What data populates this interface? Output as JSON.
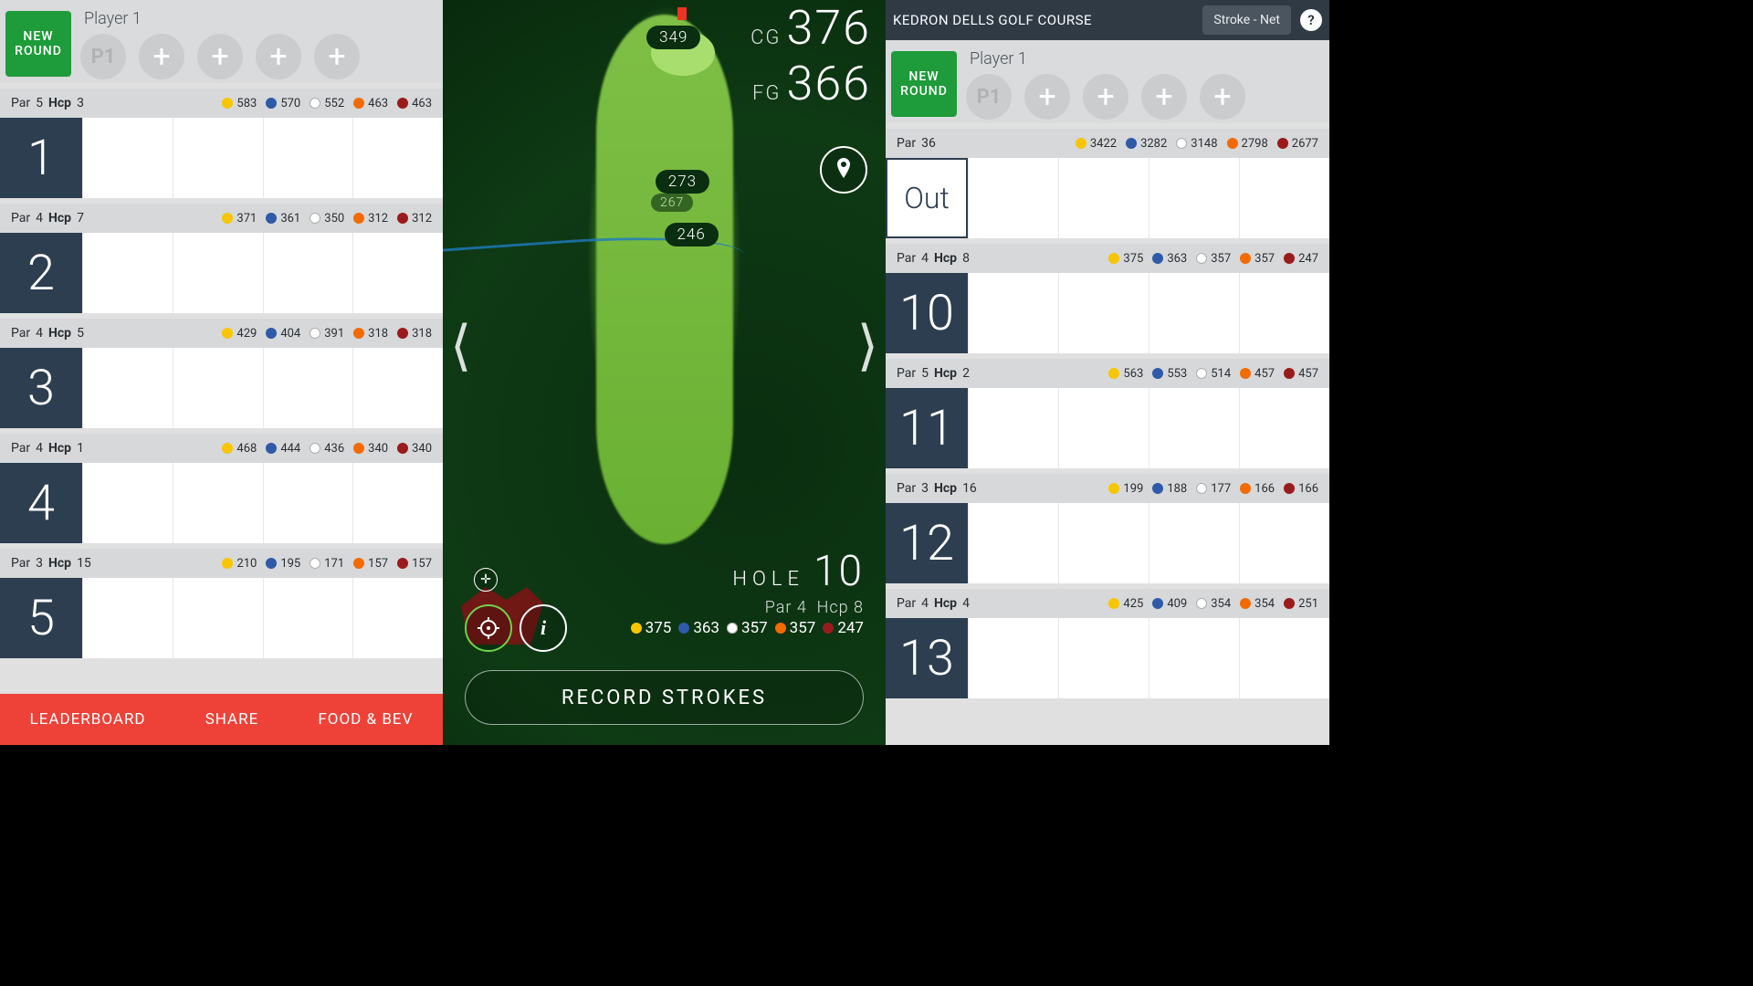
{
  "common": {
    "new_round_l1": "NEW",
    "new_round_l2": "ROUND",
    "player1_label": "Player 1",
    "p1": "P1",
    "par_label": "Par",
    "hcp_label": "Hcp"
  },
  "left": {
    "holes": [
      {
        "num": "1",
        "par": "5",
        "hcp": "3",
        "tees": [
          "583",
          "570",
          "552",
          "463",
          "463"
        ]
      },
      {
        "num": "2",
        "par": "4",
        "hcp": "7",
        "tees": [
          "371",
          "361",
          "350",
          "312",
          "312"
        ]
      },
      {
        "num": "3",
        "par": "4",
        "hcp": "5",
        "tees": [
          "429",
          "404",
          "391",
          "318",
          "318"
        ]
      },
      {
        "num": "4",
        "par": "4",
        "hcp": "1",
        "tees": [
          "468",
          "444",
          "436",
          "340",
          "340"
        ]
      },
      {
        "num": "5",
        "par": "3",
        "hcp": "15",
        "tees": [
          "210",
          "195",
          "171",
          "157",
          "157"
        ]
      }
    ],
    "bottom": {
      "a": "LEADERBOARD",
      "b": "SHARE",
      "c": "FOOD & BEV"
    }
  },
  "map": {
    "markers": {
      "green": "349",
      "mid1": "273",
      "mid1_under": "267",
      "mid2": "246"
    },
    "cg_label": "CG",
    "cg_val": "376",
    "fg_label": "FG",
    "fg_val": "366",
    "hole_word": "HOLE",
    "hole_num": "10",
    "par_text": "Par 4",
    "hcp_text": "Hcp 8",
    "tees": [
      "375",
      "363",
      "357",
      "357",
      "247"
    ],
    "record": "RECORD STROKES"
  },
  "right": {
    "course_name": "KEDRON DELLS GOLF COURSE",
    "mode": "Stroke - Net",
    "out_label": "Out",
    "out_par": "36",
    "out_tees": [
      "3422",
      "3282",
      "3148",
      "2798",
      "2677"
    ],
    "holes": [
      {
        "num": "10",
        "par": "4",
        "hcp": "8",
        "tees": [
          "375",
          "363",
          "357",
          "357",
          "247"
        ]
      },
      {
        "num": "11",
        "par": "5",
        "hcp": "2",
        "tees": [
          "563",
          "553",
          "514",
          "457",
          "457"
        ]
      },
      {
        "num": "12",
        "par": "3",
        "hcp": "16",
        "tees": [
          "199",
          "188",
          "177",
          "166",
          "166"
        ]
      },
      {
        "num": "13",
        "par": "4",
        "hcp": "4",
        "tees": [
          "425",
          "409",
          "354",
          "354",
          "251"
        ]
      }
    ]
  }
}
